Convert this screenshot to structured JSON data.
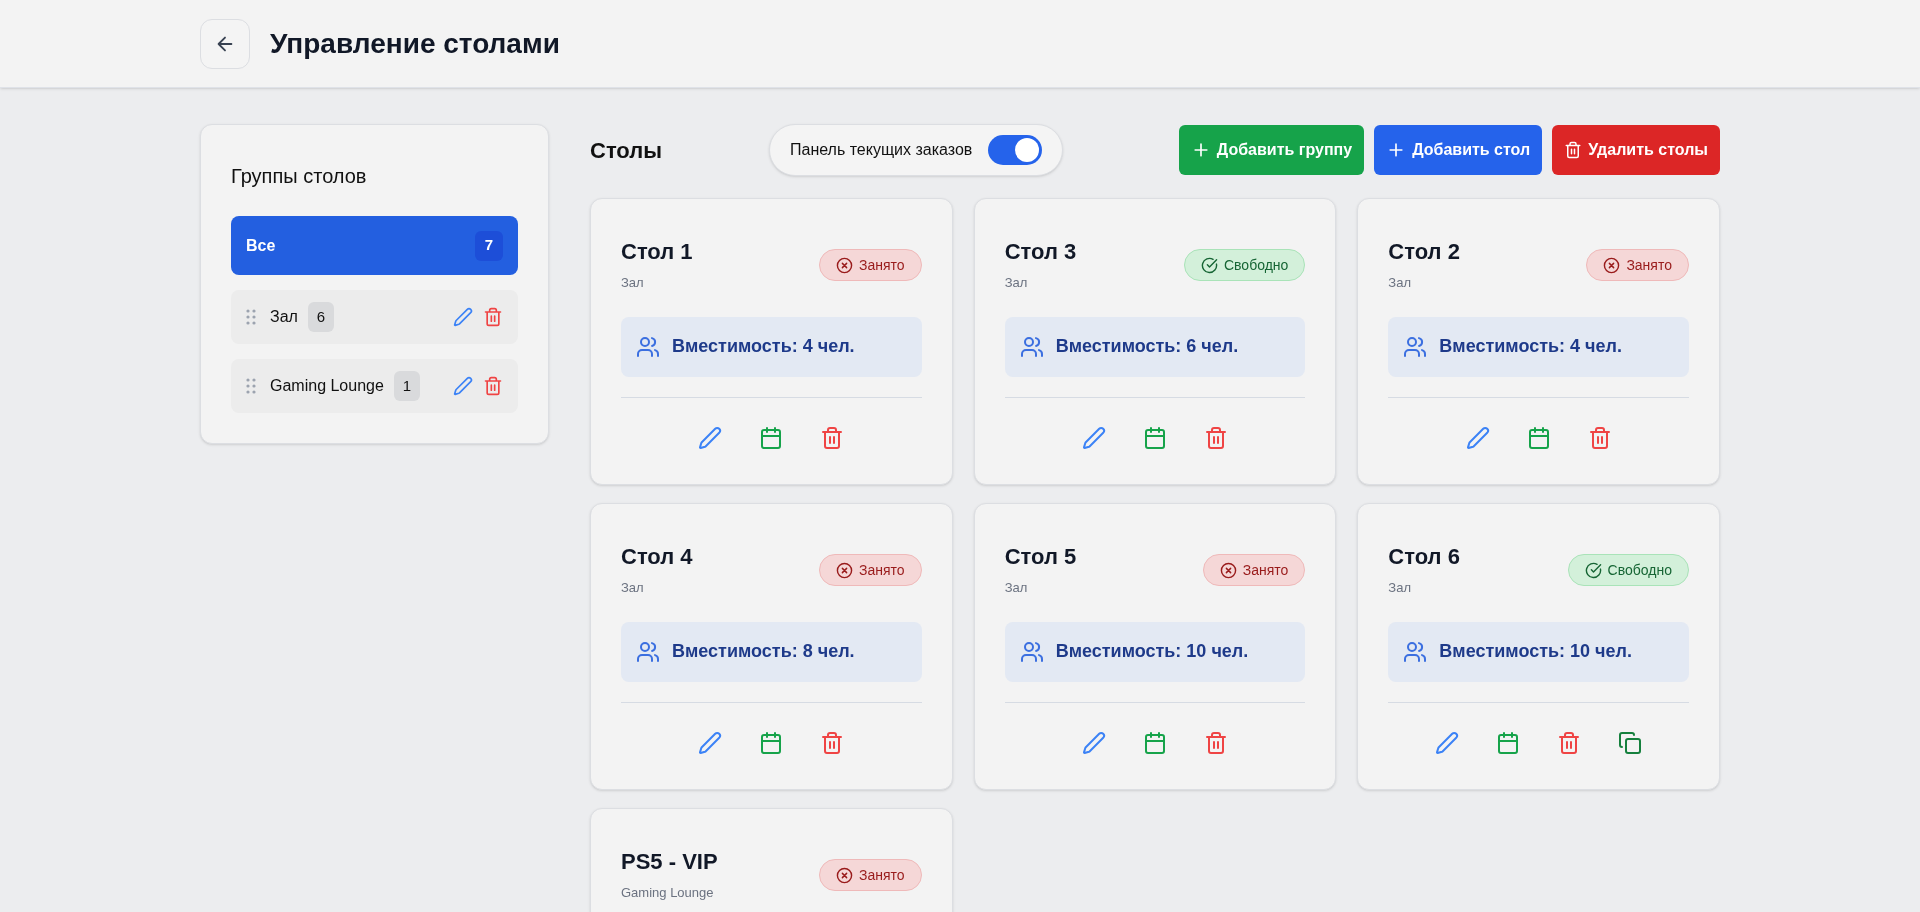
{
  "header": {
    "title": "Управление столами"
  },
  "sidebar": {
    "title": "Группы столов",
    "groups": [
      {
        "name": "Все",
        "count": "7",
        "selected": true,
        "editable": false
      },
      {
        "name": "Зал",
        "count": "6",
        "selected": false,
        "editable": true
      },
      {
        "name": "Gaming Lounge",
        "count": "1",
        "selected": false,
        "editable": true
      }
    ]
  },
  "toolbar": {
    "title": "Столы",
    "orders_panel": {
      "label": "Панель текущих заказов",
      "on": true
    },
    "buttons": [
      {
        "kind": "add",
        "label": "Добавить группу",
        "color": "#16a34a"
      },
      {
        "kind": "add",
        "label": "Добавить стол",
        "color": "#2563eb"
      },
      {
        "kind": "delete",
        "label": "Удалить столы",
        "color": "#dc2626"
      }
    ]
  },
  "tables": [
    {
      "name": "Стол 1",
      "group": "Зал",
      "occupied": true,
      "status_label": "Занято",
      "capacity": "Вместимость: 4 чел.",
      "copy_action": false
    },
    {
      "name": "Стол 3",
      "group": "Зал",
      "occupied": false,
      "status_label": "Свободно",
      "capacity": "Вместимость: 6 чел.",
      "copy_action": false
    },
    {
      "name": "Стол 2",
      "group": "Зал",
      "occupied": true,
      "status_label": "Занято",
      "capacity": "Вместимость: 4 чел.",
      "copy_action": false
    },
    {
      "name": "Стол 4",
      "group": "Зал",
      "occupied": true,
      "status_label": "Занято",
      "capacity": "Вместимость: 8 чел.",
      "copy_action": false
    },
    {
      "name": "Стол 5",
      "group": "Зал",
      "occupied": true,
      "status_label": "Занято",
      "capacity": "Вместимость: 10 чел.",
      "copy_action": false
    },
    {
      "name": "Стол 6",
      "group": "Зал",
      "occupied": false,
      "status_label": "Свободно",
      "capacity": "Вместимость: 10 чел.",
      "copy_action": true
    },
    {
      "name": "PS5 - VIP",
      "group": "Gaming Lounge",
      "occupied": true,
      "status_label": "Занято"
    }
  ]
}
